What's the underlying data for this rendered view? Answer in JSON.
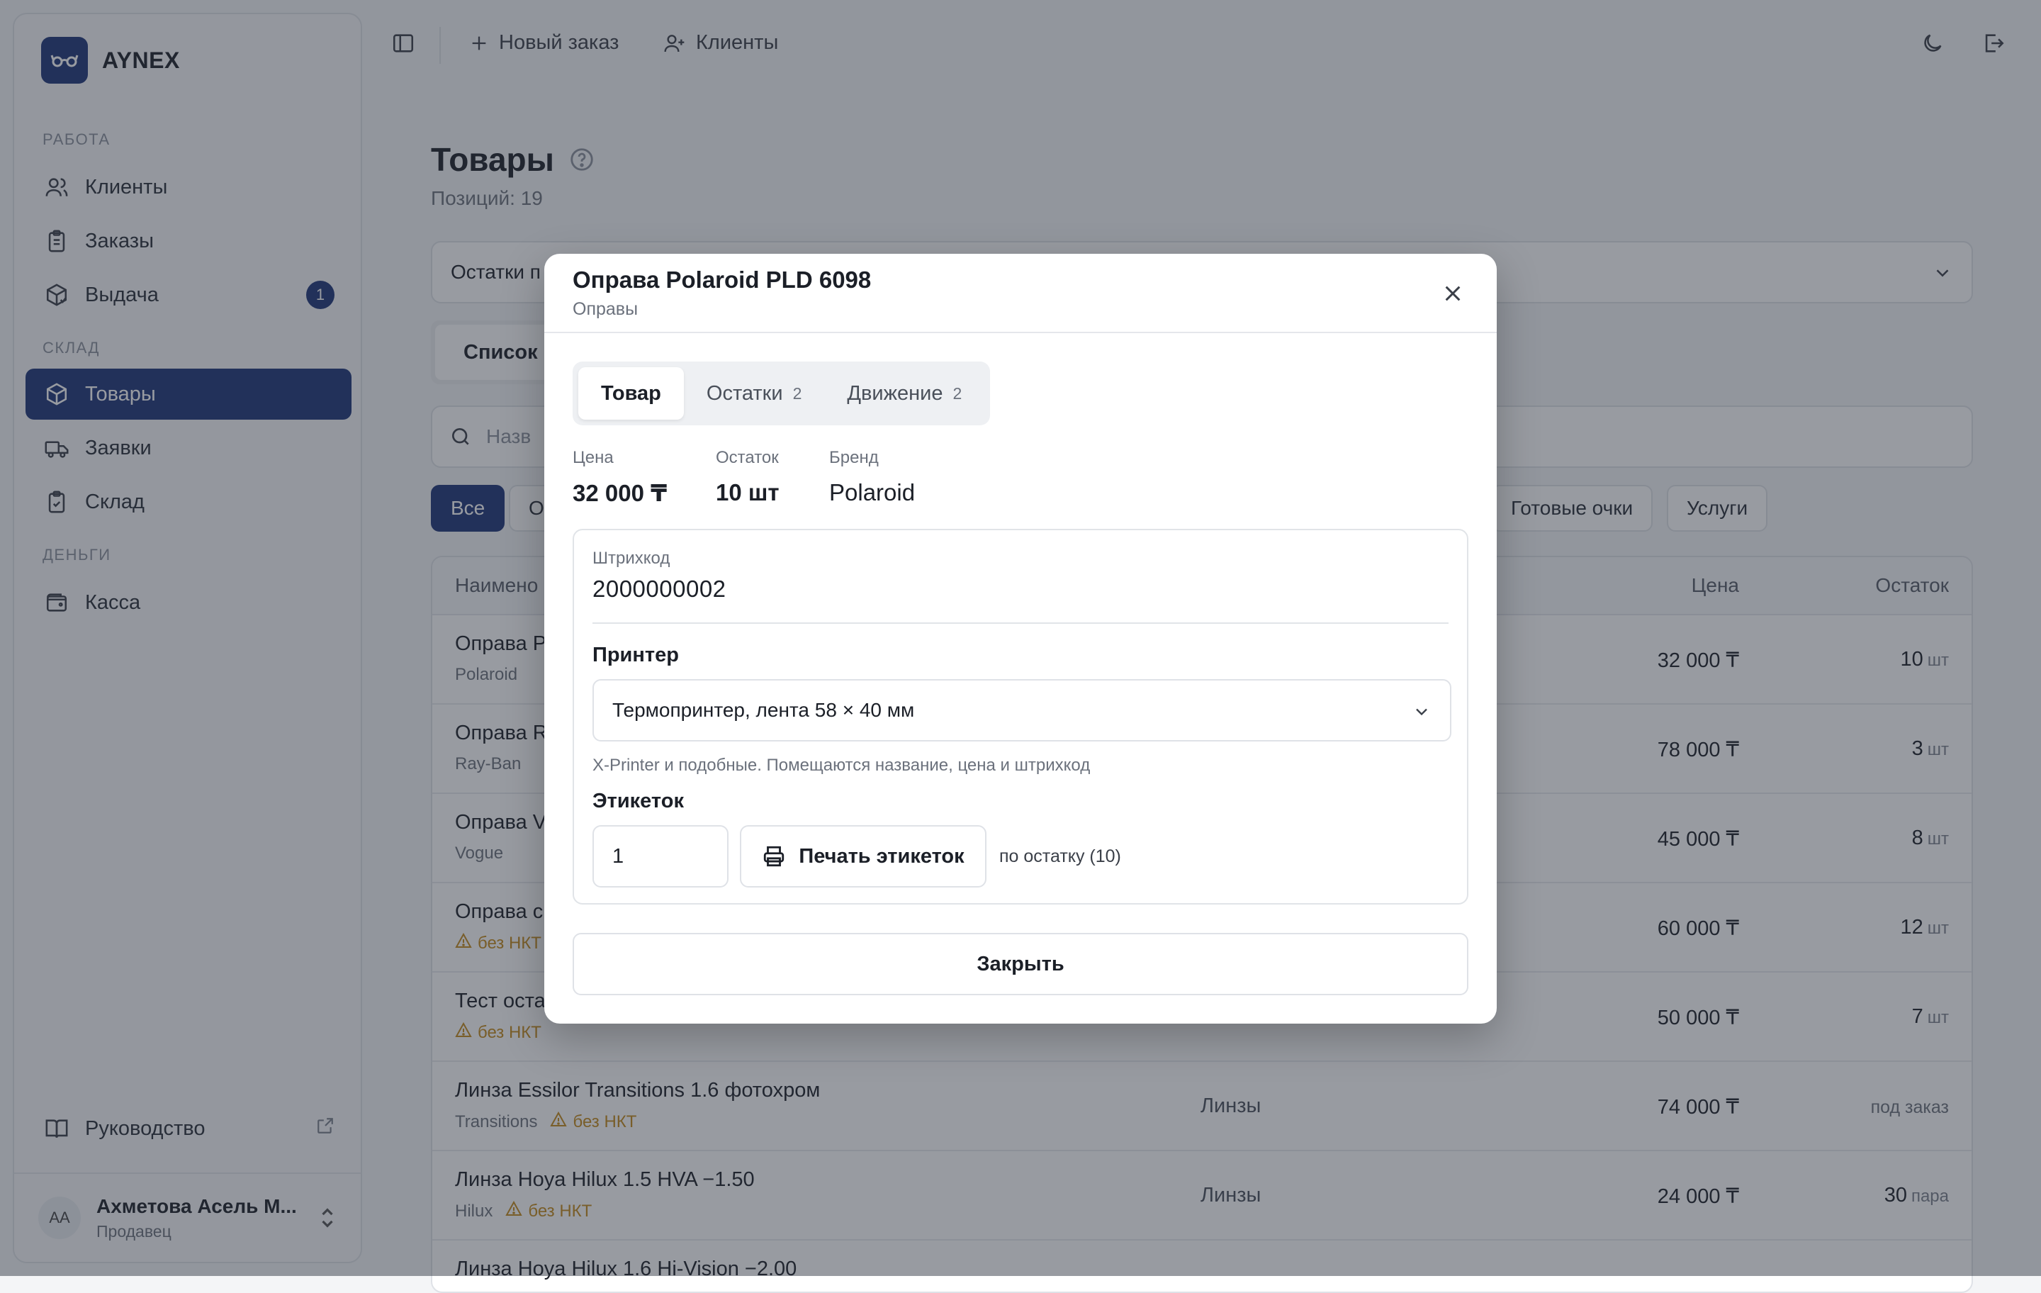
{
  "brand": {
    "name": "AYNEX"
  },
  "sidebar": {
    "sections": [
      "РАБОТА",
      "СКЛАД",
      "ДЕНЬГИ"
    ],
    "items": [
      {
        "label": "Клиенты",
        "icon": "users-icon"
      },
      {
        "label": "Заказы",
        "icon": "clipboard-icon"
      },
      {
        "label": "Выдача",
        "icon": "package-icon",
        "badge": "1"
      },
      {
        "label": "Товары",
        "icon": "box-icon",
        "active": true
      },
      {
        "label": "Заявки",
        "icon": "truck-icon"
      },
      {
        "label": "Склад",
        "icon": "clipboard-check-icon"
      },
      {
        "label": "Касса",
        "icon": "wallet-icon"
      }
    ],
    "guide": {
      "label": "Руководство",
      "icon": "book-icon"
    },
    "user": {
      "initials": "АА",
      "name": "Ахметова Асель М...",
      "role": "Продавец"
    }
  },
  "topbar": {
    "new_order": "Новый заказ",
    "clients": "Клиенты"
  },
  "page": {
    "title": "Товары",
    "count": "Позиций: 19",
    "select_value": "Остатки п",
    "view_tab": "Список",
    "search_placeholder": "Назв",
    "chips": [
      "Все",
      "О",
      "Готовые очки",
      "Услуги"
    ]
  },
  "table": {
    "headers": {
      "name": "Наимено",
      "price": "Цена",
      "stock": "Остаток"
    },
    "rows": [
      {
        "name": "Оправа P",
        "brand": "Polaroid",
        "warn": "",
        "category": "",
        "price": "32 000 ₸",
        "stock": "10",
        "unit": "шт"
      },
      {
        "name": "Оправа R",
        "brand": "Ray-Ban",
        "warn": "",
        "category": "",
        "price": "78 000 ₸",
        "stock": "3",
        "unit": "шт"
      },
      {
        "name": "Оправа V",
        "brand": "Vogue",
        "warn": "",
        "category": "",
        "price": "45 000 ₸",
        "stock": "8",
        "unit": "шт"
      },
      {
        "name": "Оправа с",
        "brand": "",
        "warn": "без НКТ",
        "category": "",
        "price": "60 000 ₸",
        "stock": "12",
        "unit": "шт"
      },
      {
        "name": "Тест оста",
        "brand": "",
        "warn": "без НКТ",
        "category": "",
        "price": "50 000 ₸",
        "stock": "7",
        "unit": "шт"
      },
      {
        "name": "Линза Essilor Transitions 1.6 фотохром",
        "brand": "Transitions",
        "warn": "без НКТ",
        "category": "Линзы",
        "price": "74 000 ₸",
        "stock": "под заказ",
        "unit": ""
      },
      {
        "name": "Линза Hoya Hilux 1.5 HVA −1.50",
        "brand": "Hilux",
        "warn": "без НКТ",
        "category": "Линзы",
        "price": "24 000 ₸",
        "stock": "30",
        "unit": "пара"
      },
      {
        "name": "Линза Hoya Hilux 1.6 Hi-Vision −2.00",
        "brand": "",
        "warn": "",
        "category": "",
        "price": "",
        "stock": "",
        "unit": ""
      }
    ]
  },
  "modal": {
    "title": "Оправа Polaroid PLD 6098",
    "subtitle": "Оправы",
    "tabs": [
      {
        "label": "Товар",
        "count": ""
      },
      {
        "label": "Остатки",
        "count": "2"
      },
      {
        "label": "Движение",
        "count": "2"
      }
    ],
    "stats": {
      "price_label": "Цена",
      "price": "32 000 ₸",
      "stock_label": "Остаток",
      "stock": "10 шт",
      "brand_label": "Бренд",
      "brand": "Polaroid"
    },
    "barcode_label": "Штрихкод",
    "barcode": "2000000002",
    "printer_label": "Принтер",
    "printer_value": "Термопринтер, лента 58 × 40 мм",
    "printer_hint": "X-Printer и подобные. Помещаются название, цена и штрихкод",
    "labels_label": "Этикеток",
    "labels_count": "1",
    "print_button": "Печать этикеток",
    "labels_hint": "по остатку (10)",
    "close_button": "Закрыть"
  },
  "colors": {
    "accent": "#1d3478",
    "warning": "#c48a1b"
  }
}
